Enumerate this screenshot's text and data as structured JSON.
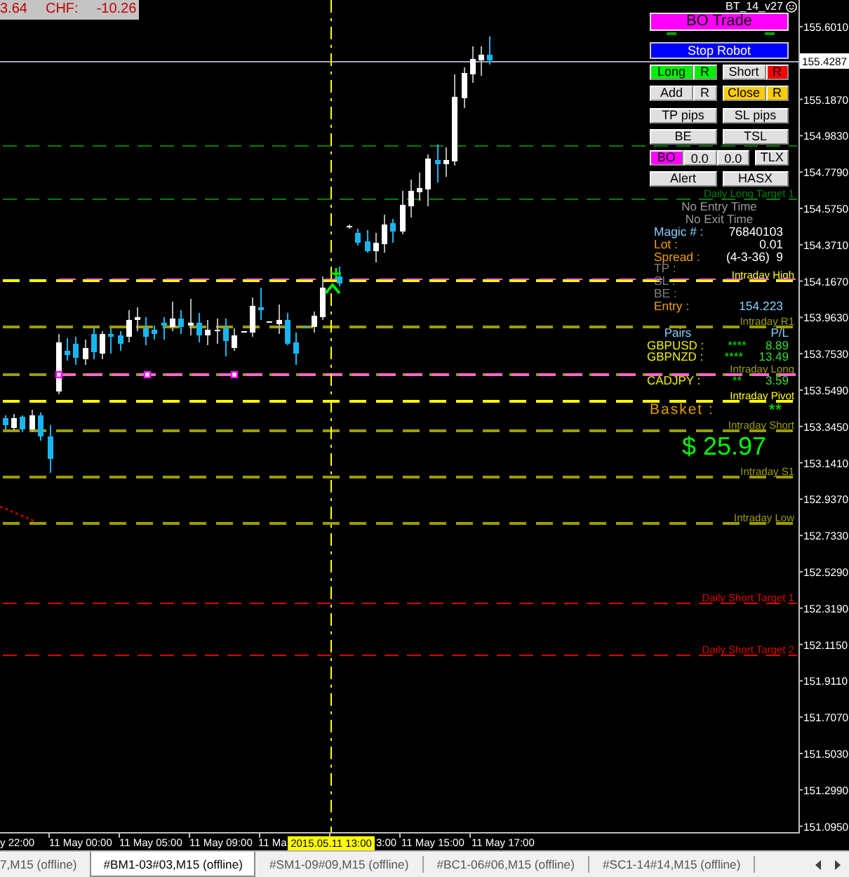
{
  "account_strip": {
    "values": [
      "3.64",
      "CHF:",
      "-10.26"
    ]
  },
  "robot": {
    "name": "BT_14_v27"
  },
  "panel": {
    "trade_button": {
      "label": "BO Trade"
    },
    "stop_button": {
      "label": "Stop Robot"
    },
    "button_rows": [
      {
        "groups": [
          {
            "buttons": [
              {
                "label": "Long",
                "kind": "button",
                "color": "#00ee00"
              },
              {
                "label": "R",
                "kind": "button",
                "color": "#00ee00"
              }
            ]
          },
          {
            "buttons": [
              {
                "label": "Short",
                "kind": "button",
                "color": "#e0e0e0"
              },
              {
                "label": "R",
                "kind": "button",
                "color": "#ff0000"
              }
            ]
          }
        ]
      },
      {
        "groups": [
          {
            "buttons": [
              {
                "label": "Add",
                "kind": "button",
                "color": "#e0e0e0"
              },
              {
                "label": "R",
                "kind": "button",
                "color": "#e0e0e0"
              }
            ]
          },
          {
            "buttons": [
              {
                "label": "Close",
                "kind": "button",
                "color": "#ffcc00"
              },
              {
                "label": "R",
                "kind": "button",
                "color": "#ffcc00"
              }
            ]
          }
        ]
      },
      {
        "groups": [
          {
            "buttons": [
              {
                "label": "TP pips",
                "kind": "button",
                "color": "#e0e0e0"
              }
            ]
          },
          {
            "buttons": [
              {
                "label": "SL pips",
                "kind": "button",
                "color": "#e0e0e0"
              }
            ]
          }
        ]
      },
      {
        "groups": [
          {
            "buttons": [
              {
                "label": "BE",
                "kind": "button",
                "color": "#e0e0e0"
              }
            ]
          },
          {
            "buttons": [
              {
                "label": "TSL",
                "kind": "button",
                "color": "#e0e0e0"
              }
            ]
          }
        ]
      },
      {
        "groups": [
          {
            "buttons": [
              {
                "label": "BO",
                "kind": "button",
                "color": "#ff00ff"
              },
              {
                "value": "0.0",
                "kind": "field",
                "color": "#e0e0e0"
              },
              {
                "value": "0.0",
                "kind": "field",
                "color": "#e0e0e0"
              }
            ]
          },
          {
            "buttons": [
              {
                "label": "TLX",
                "kind": "button",
                "color": "#e0e0e0"
              }
            ]
          }
        ]
      },
      {
        "groups": [
          {
            "buttons": [
              {
                "label": "Alert",
                "kind": "button",
                "color": "#e0e0e0"
              }
            ]
          },
          {
            "buttons": [
              {
                "label": "HASX",
                "kind": "button",
                "color": "#e0e0e0"
              }
            ]
          }
        ]
      }
    ],
    "status": [
      "No Entry Time",
      "No Exit Time"
    ],
    "info": [
      {
        "label": "Magic # :",
        "value": "76840103",
        "kind": "value",
        "color": "#87cefa"
      },
      {
        "label": "Lot :",
        "value": "0.01",
        "kind": "value",
        "color": "#f0a000"
      },
      {
        "label": "Spread :",
        "value": "(4-3-36)  9",
        "kind": "value",
        "color": "#f0a000"
      },
      {
        "label": "TP :",
        "kind": "value",
        "color": "#808080"
      },
      {
        "label": "SL :",
        "kind": "value",
        "color": "#808080"
      },
      {
        "label": "BE :",
        "kind": "value",
        "color": "#808080"
      },
      {
        "label": "Entry :",
        "value": "154.223",
        "kind": "price",
        "color": "#f0a000"
      }
    ],
    "pairs": {
      "columns": [
        "Pairs",
        "P/L"
      ],
      "rows": [
        {
          "pair": "GBPUSD :",
          "marks": "****",
          "pl": "8.89"
        },
        {
          "pair": "GBPNZD :",
          "marks": "****",
          "pl": "13.49"
        },
        {
          "pair": "CADJPY :",
          "marks": "**",
          "pl": "3.59"
        }
      ]
    },
    "basket": {
      "label": "Basket :",
      "marks": "**",
      "total": "$ 25.97"
    }
  },
  "levels": [
    {
      "kind": "daily",
      "color": "#008000"
    },
    {
      "label": "Daily Long Target 1",
      "kind": "daily",
      "color": "#008000"
    },
    {
      "label": "Intraday High",
      "kind": "intraday",
      "color": "#ffff00"
    },
    {
      "label": "Intraday R1",
      "kind": "intraday",
      "color": "#9c9c00"
    },
    {
      "label": "Intraday Long",
      "kind": "intraday",
      "color": "#9c9c00"
    },
    {
      "label": "Intraday Pivot",
      "kind": "intraday",
      "color": "#ffff00"
    },
    {
      "label": "Intraday Short",
      "kind": "intraday",
      "color": "#9c9c00"
    },
    {
      "label": "Intraday S1",
      "kind": "intraday",
      "color": "#9c9c00"
    },
    {
      "label": "Intraday Low",
      "kind": "intraday",
      "color": "#9c9c00"
    },
    {
      "label": "Daily Short Target 1",
      "kind": "daily",
      "color": "#dd0000"
    },
    {
      "label": "Daily Short Target 2",
      "kind": "daily",
      "color": "#dd0000"
    }
  ],
  "price_axis": {
    "ticks": [
      "155.6010",
      "155.1870",
      "154.9830",
      "154.7790",
      "154.5750",
      "154.3710",
      "154.1670",
      "153.9630",
      "153.7530",
      "153.5490",
      "153.3450",
      "153.1410",
      "152.9370",
      "152.7330",
      "152.5290",
      "152.3190",
      "152.1150",
      "151.9110",
      "151.7070",
      "151.5030",
      "151.2990",
      "151.0950"
    ],
    "current_price": "155.4287"
  },
  "time_axis": {
    "labels": [
      "y 22:00",
      "11 May 00:00",
      "11 May 05:00",
      "11 May 09:00",
      "11 Ma",
      "3:00",
      "11 May 15:00",
      "11 May 17:00"
    ],
    "cursor": "2015.05.11 13:00"
  },
  "tabs": [
    {
      "label": "7,M15 (offline)",
      "selected": false
    },
    {
      "label": "#BM1-03#03,M15 (offline)",
      "selected": true
    },
    {
      "label": "#SM1-09#09,M15 (offline)",
      "selected": false
    },
    {
      "label": "#BC1-06#06,M15 (offline)",
      "selected": false
    },
    {
      "label": "#SC1-14#14,M15 (offline)",
      "selected": false
    }
  ]
}
